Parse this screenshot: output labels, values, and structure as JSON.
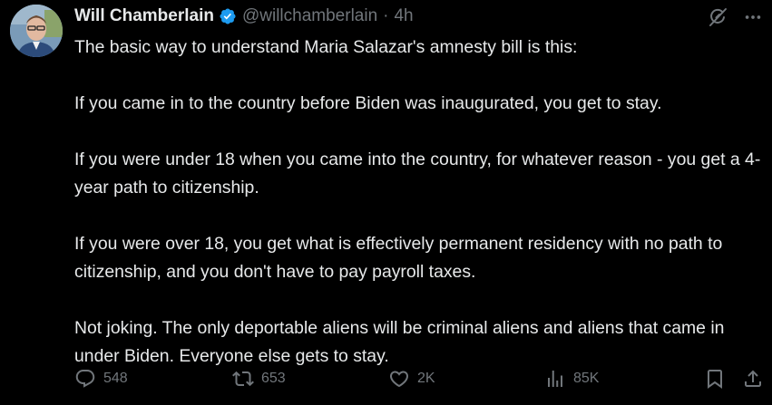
{
  "author": {
    "display_name": "Will Chamberlain",
    "handle": "@willchamberlain",
    "separator": "·",
    "time_ago": "4h",
    "verified_icon": "verified-badge-icon",
    "colors": {
      "verified": "#1d9bf0"
    }
  },
  "header_actions": {
    "grok_icon": "grok-icon",
    "more_icon": "more-icon"
  },
  "tweet": {
    "paragraphs": [
      "The basic way to understand Maria Salazar's amnesty bill is this:",
      "If you came in to the country before Biden was inaugurated, you get to stay.",
      "If you were under 18 when you came into the country, for whatever reason - you get a 4-year path to citizenship.",
      "If you were over 18, you get what is effectively permanent residency with no path to citizenship, and you don't have to pay payroll taxes.",
      "Not joking. The only deportable aliens will be criminal aliens and aliens that came in under Biden. Everyone else gets to stay."
    ]
  },
  "actions": {
    "replies": "548",
    "reposts": "653",
    "likes": "2K",
    "views": "85K"
  },
  "colors": {
    "background": "#000000",
    "text": "#e7e9ea",
    "secondary": "#71767b"
  }
}
